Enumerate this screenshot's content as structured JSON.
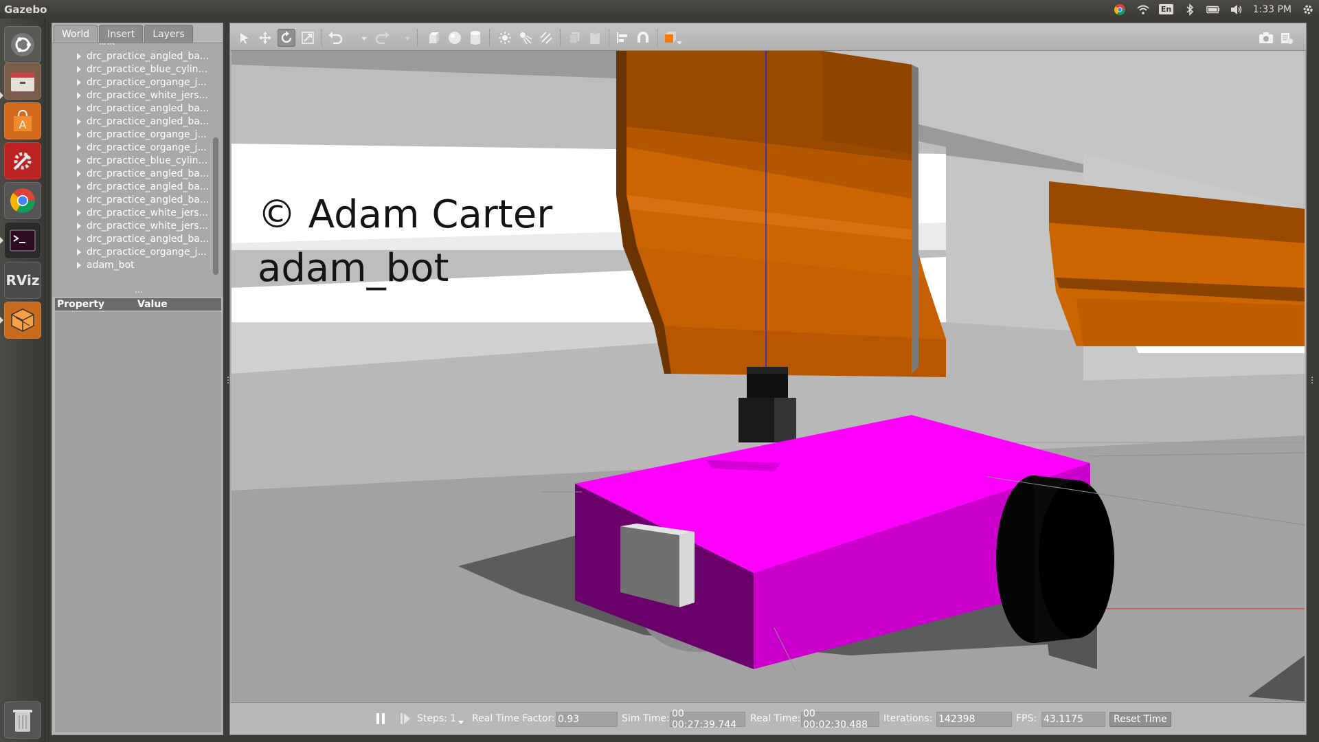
{
  "topbar": {
    "app_title": "Gazebo",
    "time": "1:33 PM",
    "keyboard_layout": "En",
    "icons": [
      "chrome-icon",
      "wifi-icon",
      "keyboard-icon",
      "bluetooth-icon",
      "battery-icon",
      "volume-icon",
      "settings-gear-icon"
    ]
  },
  "launcher": {
    "items": [
      "ubuntu-dash",
      "files",
      "software-center",
      "system-settings",
      "chrome",
      "terminal",
      "rviz",
      "gazebo",
      "trash"
    ],
    "rviz_label": "RViz"
  },
  "left_panel": {
    "tabs": [
      {
        "label": "World",
        "active": true
      },
      {
        "label": "Insert",
        "active": false
      },
      {
        "label": "Layers",
        "active": false
      }
    ],
    "tree_items": [
      "drc_practice_angled_ba...",
      "drc_practice_blue_cylin...",
      "drc_practice_organge_j...",
      "drc_practice_white_jers...",
      "drc_practice_angled_ba...",
      "drc_practice_angled_ba...",
      "drc_practice_organge_j...",
      "drc_practice_organge_j...",
      "drc_practice_blue_cylin...",
      "drc_practice_angled_ba...",
      "drc_practice_angled_ba...",
      "drc_practice_angled_ba...",
      "drc_practice_white_jers...",
      "drc_practice_white_jers...",
      "drc_practice_angled_ba...",
      "drc_practice_organge_j...",
      "adam_bot"
    ],
    "partial_top_item": "link",
    "property_header": "Property",
    "value_header": "Value"
  },
  "toolbar": {
    "tools": [
      "select-mode",
      "translate-mode",
      "rotate-mode",
      "scale-mode",
      "undo",
      "redo",
      "box-shape",
      "sphere-shape",
      "cylinder-shape",
      "point-light",
      "spot-light",
      "directional-light",
      "copy",
      "paste",
      "align",
      "snap",
      "view-angle",
      "screenshot",
      "log"
    ],
    "active_tool": "rotate-mode"
  },
  "scene": {
    "watermark_line1": "© Adam Carter",
    "watermark_line2": "adam_bot",
    "colors": {
      "barrier_orange": "#cc6400",
      "barrier_dark": "#8a4300",
      "robot_magenta": "#ff00ff",
      "robot_side": "#6a006a",
      "ground": "#a6a6a6",
      "wall_white": "#ffffff"
    }
  },
  "statusbar": {
    "steps_label": "Steps:",
    "steps_value": "1",
    "rtf_label": "Real Time Factor:",
    "rtf_value": "0.93",
    "sim_time_label": "Sim Time:",
    "sim_time_value": "00 00:27:39.744",
    "real_time_label": "Real Time:",
    "real_time_value": "00 00:02:30.488",
    "iterations_label": "Iterations:",
    "iterations_value": "142398",
    "fps_label": "FPS:",
    "fps_value": "43.1175",
    "reset_button": "Reset Time"
  }
}
